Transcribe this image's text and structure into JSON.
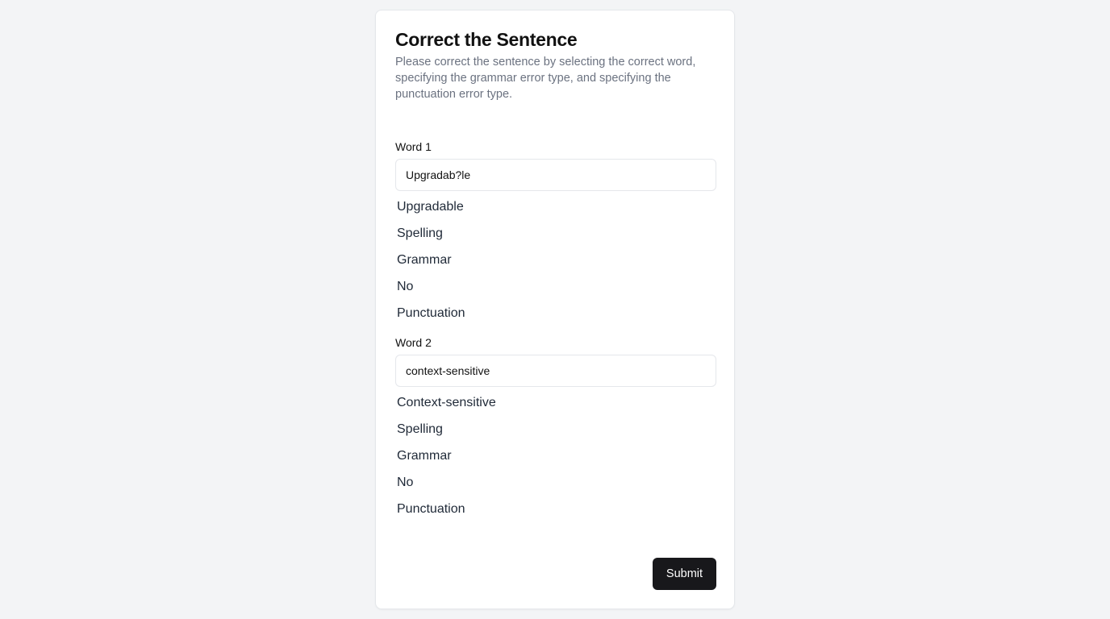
{
  "form": {
    "title": "Correct the Sentence",
    "description": "Please correct the sentence by selecting the correct word, specifying the grammar error type, and specifying the punctuation error type.",
    "submit_label": "Submit"
  },
  "words": [
    {
      "label": "Word 1",
      "value": "Upgradab?le",
      "options": [
        "Upgradable",
        "Spelling",
        "Grammar",
        "No",
        "Punctuation"
      ]
    },
    {
      "label": "Word 2",
      "value": "context-sensitive",
      "options": [
        "Context-sensitive",
        "Spelling",
        "Grammar",
        "No",
        "Punctuation"
      ]
    }
  ]
}
